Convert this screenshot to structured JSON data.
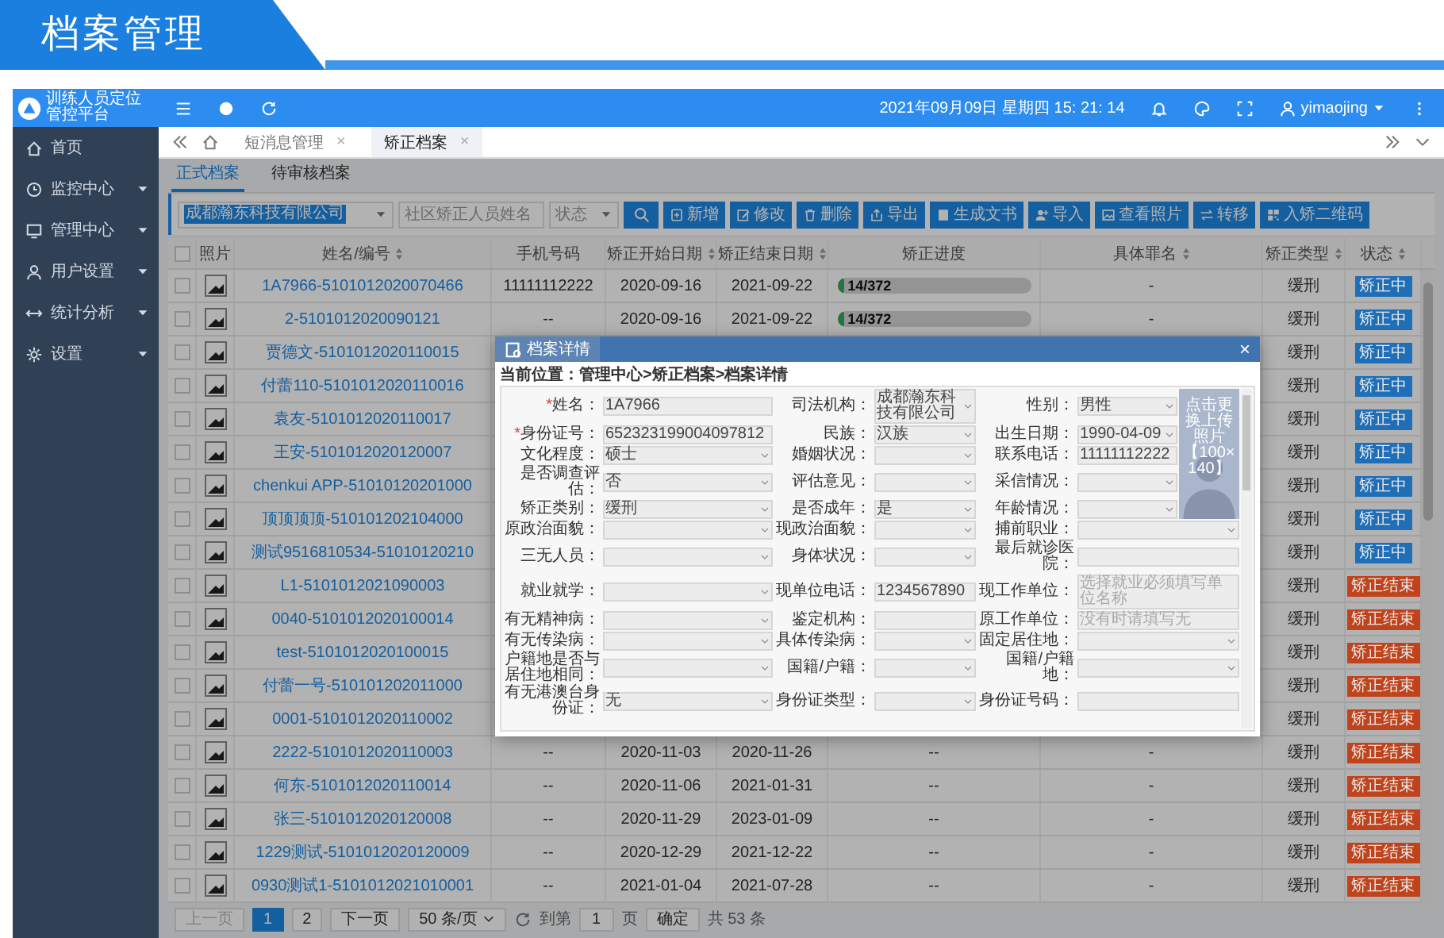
{
  "page_title": "档案管理",
  "app": {
    "name_lines": [
      "训练人员定位",
      "管控平台"
    ],
    "datetime": "2021年09月09日 星期四 15: 21: 14",
    "user": "yimaojing"
  },
  "sidebar": {
    "items": [
      {
        "label": "首页",
        "expandable": false
      },
      {
        "label": "监控中心",
        "expandable": true
      },
      {
        "label": "管理中心",
        "expandable": true
      },
      {
        "label": "用户设置",
        "expandable": true
      },
      {
        "label": "统计分析",
        "expandable": true
      },
      {
        "label": "设置",
        "expandable": true
      }
    ]
  },
  "tabs": [
    {
      "label": "短消息管理",
      "close": "×",
      "selected": false
    },
    {
      "label": "矫正档案",
      "close": "×",
      "selected": true
    }
  ],
  "subtabs": [
    {
      "label": "正式档案",
      "selected": true
    },
    {
      "label": "待审核档案",
      "selected": false
    }
  ],
  "filters": {
    "org": "成都瀚东科技有限公司",
    "name_placeholder": "社区矫正人员姓名",
    "status_placeholder": "状态"
  },
  "toolbar": [
    "新增",
    "修改",
    "删除",
    "导出",
    "生成文书",
    "导入",
    "查看照片",
    "转移",
    "入矫二维码"
  ],
  "table": {
    "select_all": false,
    "columns": [
      {
        "label": "照片",
        "sortable": false
      },
      {
        "label": "姓名/编号",
        "sortable": true
      },
      {
        "label": "手机号码",
        "sortable": false
      },
      {
        "label": "矫正开始日期",
        "sortable": true
      },
      {
        "label": "矫正结束日期",
        "sortable": true
      },
      {
        "label": "矫正进度",
        "sortable": false
      },
      {
        "label": "具体罪名",
        "sortable": true
      },
      {
        "label": "矫正类型",
        "sortable": true
      },
      {
        "label": "状态",
        "sortable": true
      }
    ],
    "rows": [
      {
        "checked": false,
        "name": "1A7966-5101012020070466",
        "phone": "11111112222",
        "start": "2020-09-16",
        "end": "2021-09-22",
        "progress": {
          "text": "14/372",
          "level": 0.038
        },
        "crime": "-",
        "type": "缓刑",
        "status": {
          "label": "矫正中",
          "color": "#1e6fb8"
        }
      },
      {
        "checked": false,
        "name": "2-5101012020090121",
        "phone": "--",
        "start": "2020-09-16",
        "end": "2021-09-22",
        "progress": {
          "text": "14/372",
          "level": 0.038
        },
        "crime": "-",
        "type": "缓刑",
        "status": {
          "label": "矫正中",
          "color": "#1e6fb8"
        }
      },
      {
        "checked": false,
        "name": "贾德文-5101012020110015",
        "type": "缓刑",
        "status": {
          "label": "矫正中",
          "color": "#1e6fb8"
        }
      },
      {
        "checked": false,
        "name": "付蕾110-5101012020110016",
        "type": "缓刑",
        "status": {
          "label": "矫正中",
          "color": "#1e6fb8"
        }
      },
      {
        "checked": false,
        "name": "袁友-5101012020110017",
        "type": "缓刑",
        "status": {
          "label": "矫正中",
          "color": "#1e6fb8"
        }
      },
      {
        "checked": false,
        "name": "王安-5101012020120007",
        "type": "缓刑",
        "status": {
          "label": "矫正中",
          "color": "#1e6fb8"
        }
      },
      {
        "checked": false,
        "name": "chenkui APP-51010120201000",
        "type": "缓刑",
        "status": {
          "label": "矫正中",
          "color": "#1e6fb8"
        }
      },
      {
        "checked": false,
        "name": "顶顶顶顶-510101202104000",
        "type": "缓刑",
        "status": {
          "label": "矫正中",
          "color": "#1e6fb8"
        }
      },
      {
        "checked": false,
        "name": "测试9516810534-51010120210",
        "type": "缓刑",
        "status": {
          "label": "矫正中",
          "color": "#1e6fb8"
        }
      },
      {
        "checked": false,
        "name": "L1-5101012021090003",
        "type": "缓刑",
        "status": {
          "label": "矫正结束",
          "color": "#c0431b"
        }
      },
      {
        "checked": false,
        "name": "0040-5101012020100014",
        "type": "缓刑",
        "status": {
          "label": "矫正结束",
          "color": "#c0431b"
        }
      },
      {
        "checked": false,
        "name": "test-5101012020100015",
        "type": "缓刑",
        "status": {
          "label": "矫正结束",
          "color": "#c0431b"
        }
      },
      {
        "checked": false,
        "name": "付蕾一号-510101202011000",
        "type": "缓刑",
        "status": {
          "label": "矫正结束",
          "color": "#c0431b"
        }
      },
      {
        "checked": false,
        "name": "0001-5101012020110002",
        "type": "缓刑",
        "status": {
          "label": "矫正结束",
          "color": "#c0431b"
        }
      },
      {
        "checked": false,
        "name": "2222-5101012020110003",
        "phone": "--",
        "start": "2020-11-03",
        "end": "2020-11-26",
        "progress": "--",
        "crime": "-",
        "type": "缓刑",
        "status": {
          "label": "矫正结束",
          "color": "#c0431b"
        }
      },
      {
        "checked": false,
        "name": "何东-5101012020110014",
        "phone": "--",
        "start": "2020-11-06",
        "end": "2021-01-31",
        "progress": "--",
        "crime": "-",
        "type": "缓刑",
        "status": {
          "label": "矫正结束",
          "color": "#c0431b"
        }
      },
      {
        "checked": false,
        "name": "张三-5101012020120008",
        "phone": "--",
        "start": "2020-11-29",
        "end": "2023-01-09",
        "progress": "--",
        "crime": "-",
        "type": "缓刑",
        "status": {
          "label": "矫正结束",
          "color": "#c0431b"
        }
      },
      {
        "checked": false,
        "name": "1229测试-5101012020120009",
        "phone": "--",
        "start": "2020-12-29",
        "end": "2021-12-22",
        "progress": "--",
        "crime": "-",
        "type": "缓刑",
        "status": {
          "label": "矫正结束",
          "color": "#c0431b"
        }
      },
      {
        "checked": false,
        "name": "0930测试1-5101012021010001",
        "phone": "--",
        "start": "2021-01-04",
        "end": "2021-07-28",
        "progress": "--",
        "crime": "-",
        "type": "缓刑",
        "status": {
          "label": "矫正结束",
          "color": "#c0431b"
        }
      }
    ]
  },
  "pagination": {
    "prev": "上一页",
    "prev_disabled": true,
    "pages": [
      {
        "label": "1",
        "selected": true
      },
      {
        "label": "2",
        "selected": false
      }
    ],
    "next": "下一页",
    "page_size": "50 条/页",
    "goto_label": "到第",
    "goto_value": "1",
    "page_unit": "页",
    "confirm": "确定",
    "total": "共 53 条"
  },
  "dialog": {
    "title": "档案详情",
    "close": "×",
    "breadcrumb": "当前位置：管理中心>矫正档案>档案详情",
    "photo_hint": [
      "点击更换上传照片",
      "【100×140】"
    ],
    "rows": [
      [
        {
          "label": "姓名：",
          "required_mark": "*",
          "kind": "input",
          "value": "1A7966"
        },
        {
          "label": "司法机构：",
          "kind": "select",
          "value": "成都瀚东科技有限公司"
        },
        {
          "label": "性别：",
          "kind": "select",
          "value": "男性"
        }
      ],
      [
        {
          "label": "身份证号：",
          "required_mark": "*",
          "kind": "input",
          "value": "652323199004097812"
        },
        {
          "label": "民族：",
          "kind": "select",
          "value": "汉族"
        },
        {
          "label": "出生日期：",
          "kind": "select",
          "value": "1990-04-09"
        }
      ],
      [
        {
          "label": "文化程度：",
          "kind": "select",
          "value": "硕士"
        },
        {
          "label": "婚姻状况：",
          "kind": "select"
        },
        {
          "label": "联系电话：",
          "kind": "input",
          "value": "11111112222"
        }
      ],
      [
        {
          "label": "是否调查评估：",
          "kind": "select",
          "value": "否"
        },
        {
          "label": "评估意见：",
          "kind": "select"
        },
        {
          "label": "采信情况：",
          "kind": "select"
        }
      ],
      [
        {
          "label": "矫正类别：",
          "kind": "select",
          "value": "缓刑"
        },
        {
          "label": "是否成年：",
          "kind": "select",
          "value": "是"
        },
        {
          "label": "年龄情况：",
          "kind": "select"
        }
      ],
      [
        {
          "label": "原政治面貌：",
          "kind": "select"
        },
        {
          "label": "现政治面貌：",
          "kind": "select"
        },
        {
          "label": "捕前职业：",
          "kind": "select"
        }
      ],
      [
        {
          "label": "三无人员：",
          "kind": "select"
        },
        {
          "label": "身体状况：",
          "kind": "select"
        },
        {
          "label": "最后就诊医院：",
          "kind": "input"
        }
      ],
      [
        {
          "label": "就业就学：",
          "kind": "select"
        },
        {
          "label": "现单位电话：",
          "kind": "input",
          "value": "1234567890"
        },
        {
          "label": "现工作单位：",
          "kind": "input",
          "placeholder": "选择就业必须填写单位名称"
        }
      ],
      [
        {
          "label": "有无精神病：",
          "kind": "select"
        },
        {
          "label": "鉴定机构：",
          "kind": "input"
        },
        {
          "label": "原工作单位：",
          "kind": "input",
          "placeholder": "没有时请填写无"
        }
      ],
      [
        {
          "label": "有无传染病：",
          "kind": "select"
        },
        {
          "label": "具体传染病：",
          "kind": "select"
        },
        {
          "label": "固定居住地：",
          "kind": "select"
        }
      ],
      [
        {
          "label": "户籍地是否与居住地相同：",
          "kind": "select"
        },
        {
          "label": "国籍/户籍：",
          "kind": "select"
        },
        {
          "label": "国籍/户籍地：",
          "kind": "select"
        }
      ],
      [
        {
          "label": "有无港澳台身份证：",
          "kind": "select",
          "value": "无"
        },
        {
          "label": "身份证类型：",
          "kind": "select"
        },
        {
          "label": "身份证号码：",
          "kind": "input"
        }
      ]
    ]
  }
}
